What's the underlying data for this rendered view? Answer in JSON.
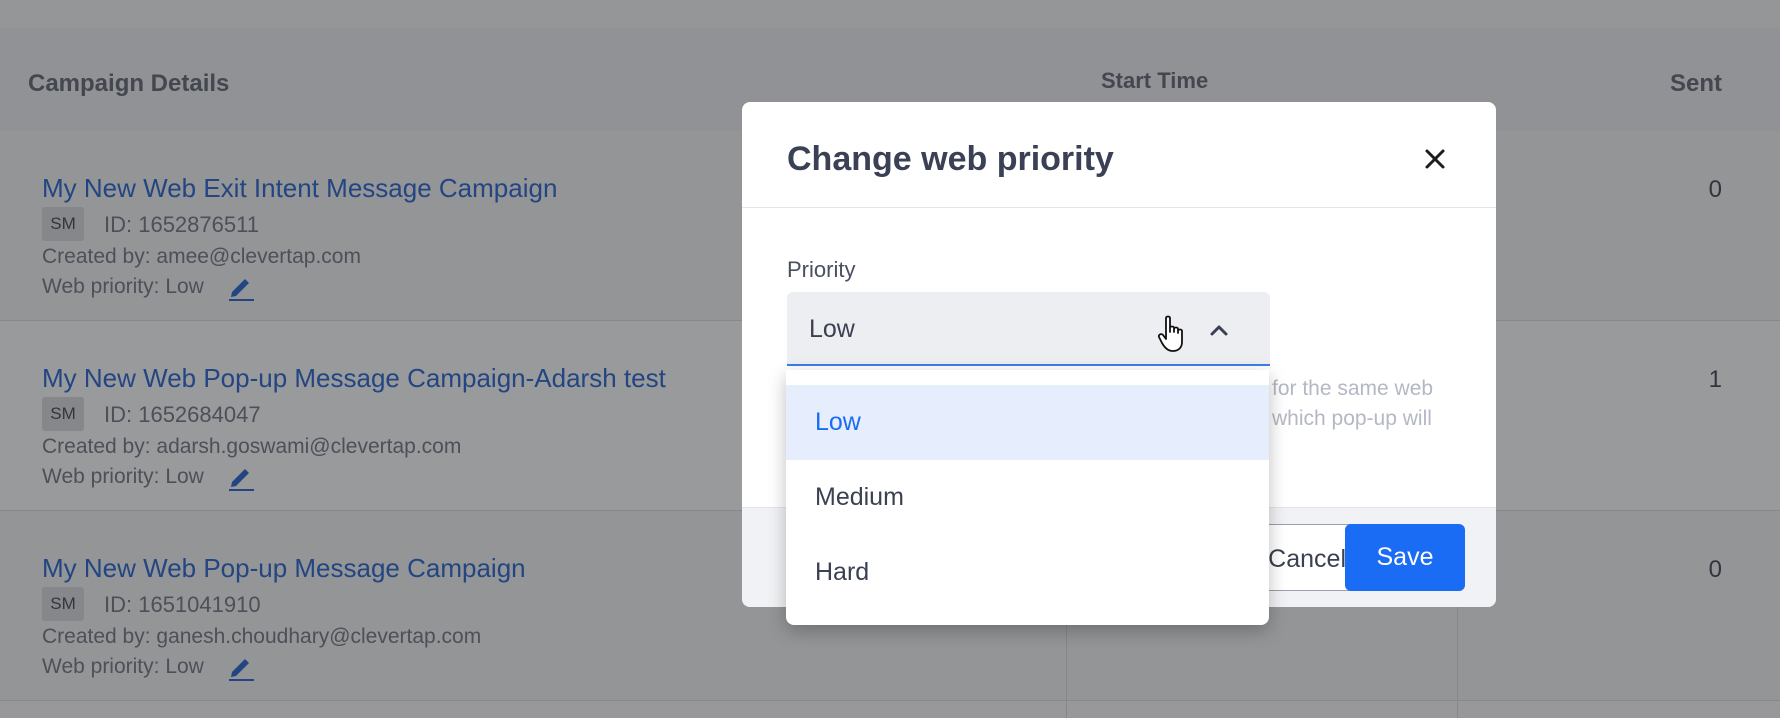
{
  "table": {
    "headers": {
      "details": "Campaign Details",
      "start_time": "Start Time",
      "sent": "Sent"
    },
    "rows": [
      {
        "name": "My New Web Exit Intent Message Campaign",
        "badge": "SM",
        "id": "ID: 1652876511",
        "created": "Created by: amee@clevertap.com",
        "priority": "Web priority: Low",
        "sent": "0"
      },
      {
        "name": "My New Web Pop-up Message Campaign-Adarsh test",
        "badge": "SM",
        "id": "ID: 1652684047",
        "created": "Created by: adarsh.goswami@clevertap.com",
        "priority": "Web priority: Low",
        "sent": "1"
      },
      {
        "name": "My New Web Pop-up Message Campaign",
        "badge": "SM",
        "id": "ID: 1651041910",
        "created": "Created by: ganesh.choudhary@clevertap.com",
        "priority": "Web priority: Low",
        "sent": "0"
      }
    ]
  },
  "modal": {
    "title": "Change web priority",
    "field_label": "Priority",
    "selected_value": "Low",
    "hint_line1": "for the same web",
    "hint_line2": "which pop-up will",
    "cancel_label": "Cancel",
    "save_label": "Save"
  },
  "dropdown": {
    "options": [
      {
        "label": "Low",
        "selected": true
      },
      {
        "label": "Medium",
        "selected": false
      },
      {
        "label": "Hard",
        "selected": false
      }
    ]
  },
  "colors": {
    "accent": "#1a6cf5",
    "link": "#1f5dcc",
    "selected_bg": "#e6eefd"
  },
  "icons": {
    "close": "close-icon",
    "chevron": "chevron-up-icon",
    "edit": "pencil-icon",
    "cursor": "hand-cursor-icon"
  }
}
